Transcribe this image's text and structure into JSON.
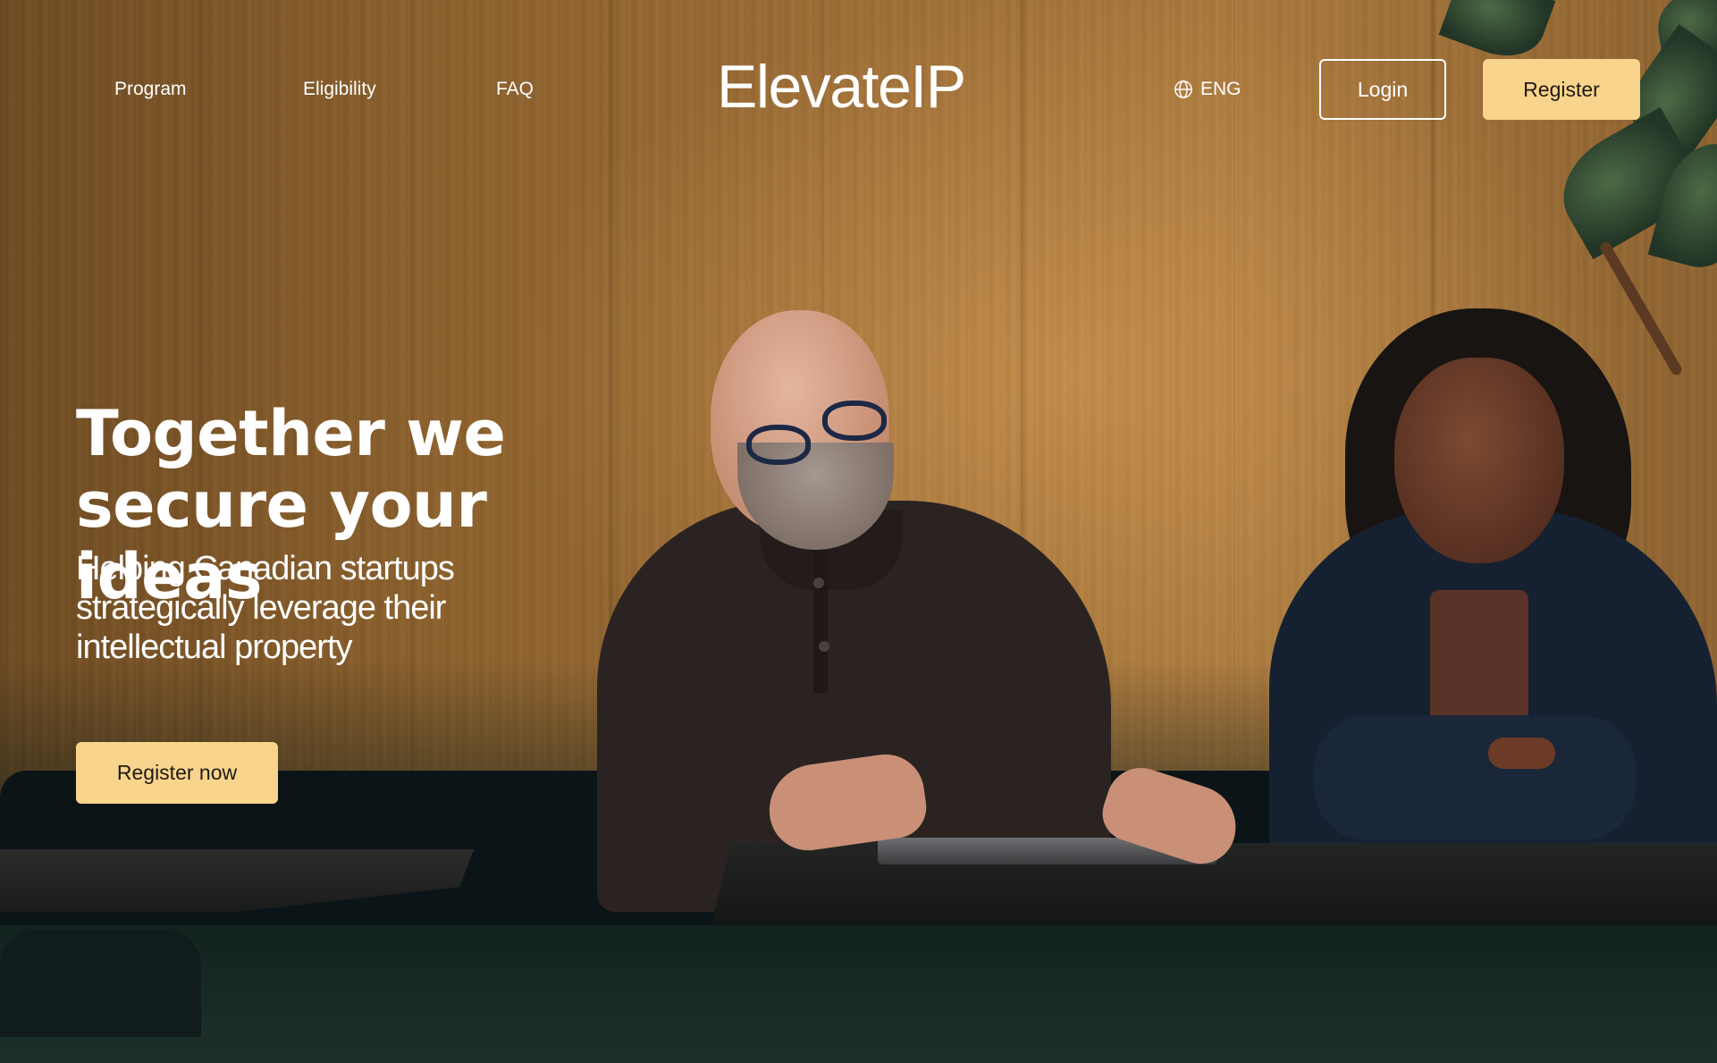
{
  "nav": {
    "links": [
      {
        "label": "Program"
      },
      {
        "label": "Eligibility"
      },
      {
        "label": "FAQ"
      }
    ],
    "logo": "ElevateIP",
    "language": {
      "label": "ENG",
      "icon": "globe-icon"
    },
    "login_label": "Login",
    "register_label": "Register"
  },
  "hero": {
    "headline_line1": "Together we",
    "headline_line2": "secure your ideas",
    "subtitle_line1": "Helping Canadian startups",
    "subtitle_line2": "strategically leverage their",
    "subtitle_line3": "intellectual property",
    "cta_label": "Register now",
    "image_description_icon": "photo-background"
  },
  "colors": {
    "accent": "#f9d48c",
    "text_on_image": "#ffffff",
    "button_text": "#1e1a14"
  }
}
